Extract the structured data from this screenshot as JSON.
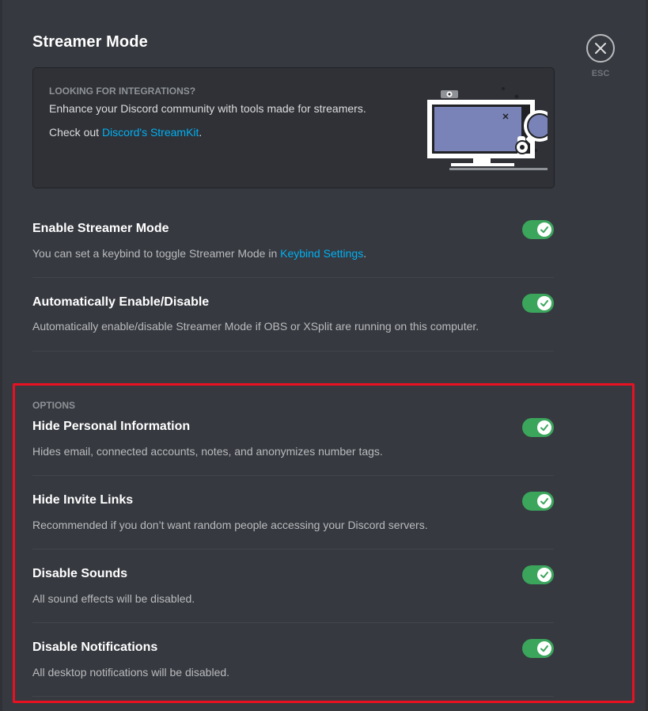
{
  "header": {
    "title": "Streamer Mode",
    "esc_label": "ESC"
  },
  "integrations": {
    "heading": "LOOKING FOR INTEGRATIONS?",
    "text": "Enhance your Discord community with tools made for streamers.",
    "check_prefix": "Check out ",
    "link_text": "Discord's StreamKit",
    "check_suffix": "."
  },
  "settings": [
    {
      "title": "Enable Streamer Mode",
      "desc_prefix": "You can set a keybind to toggle Streamer Mode in ",
      "desc_link": "Keybind Settings",
      "desc_suffix": ".",
      "enabled": true
    },
    {
      "title": "Automatically Enable/Disable",
      "desc": "Automatically enable/disable Streamer Mode if OBS or XSplit are running on this computer.",
      "enabled": true
    }
  ],
  "options": {
    "label": "OPTIONS",
    "items": [
      {
        "title": "Hide Personal Information",
        "desc": "Hides email, connected accounts, notes, and anonymizes number tags.",
        "enabled": true
      },
      {
        "title": "Hide Invite Links",
        "desc": "Recommended if you don’t want random people accessing your Discord servers.",
        "enabled": true
      },
      {
        "title": "Disable Sounds",
        "desc": "All sound effects will be disabled.",
        "enabled": true
      },
      {
        "title": "Disable Notifications",
        "desc": "All desktop notifications will be disabled.",
        "enabled": true
      }
    ]
  },
  "colors": {
    "background": "#36393f",
    "toggle_on": "#3ba55c",
    "link": "#00b0f4",
    "highlight": "#e81123"
  },
  "icons": {
    "close": "close-icon",
    "toggle_check": "check-icon",
    "illustration": "streamer-monitor-illustration"
  }
}
